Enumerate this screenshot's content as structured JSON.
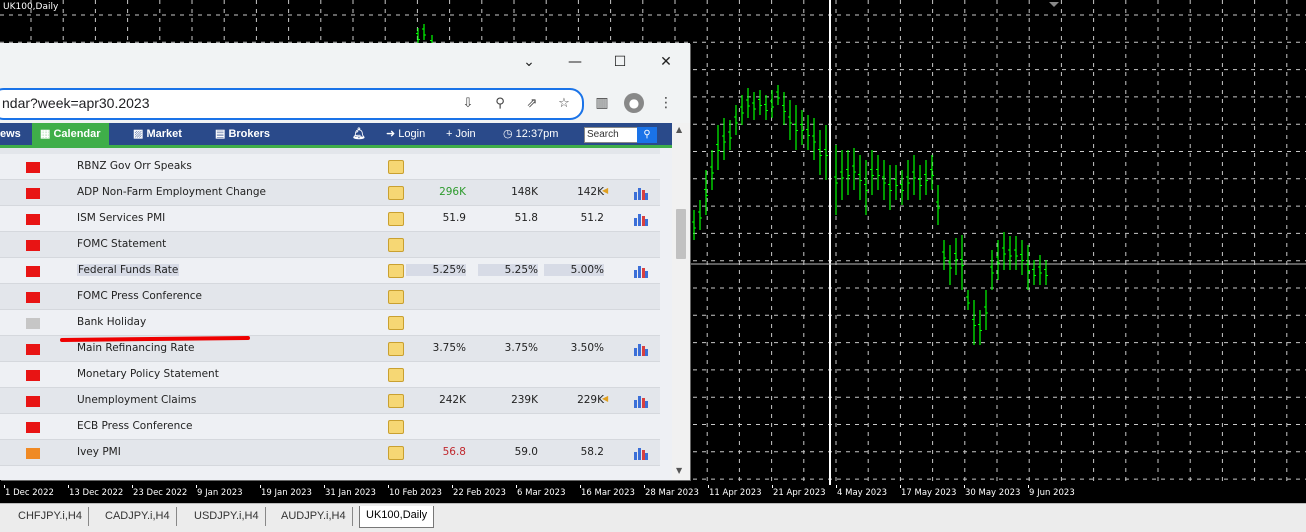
{
  "chart": {
    "title": "UK100,Daily",
    "time_labels": [
      "1 Dec 2022",
      "13 Dec 2022",
      "23 Dec 2022",
      "9 Jan 2023",
      "19 Jan 2023",
      "31 Jan 2023",
      "10 Feb 2023",
      "22 Feb 2023",
      "6 Mar 2023",
      "16 Mar 2023",
      "28 Mar 2023",
      "11 Apr 2023",
      "21 Apr 2023",
      "4 May 2023",
      "17 May 2023",
      "30 May 2023",
      "9 Jun 2023"
    ],
    "bar_color": "#00ff00",
    "grid_color": "#ffffff"
  },
  "tabs": [
    {
      "label": "CHFJPY.i,H4"
    },
    {
      "label": "CADJPY.i,H4"
    },
    {
      "label": "USDJPY.i,H4"
    },
    {
      "label": "AUDJPY.i,H4"
    },
    {
      "label": "UK100,Daily",
      "active": true
    }
  ],
  "browser": {
    "url": "ndar?week=apr30.2023",
    "nav": {
      "news": "ews",
      "calendar": "Calendar",
      "market": "Market",
      "brokers": "Brokers",
      "login": "Login",
      "join": "Join",
      "time": "12:37pm",
      "search_placeholder": "Search"
    },
    "rows": [
      {
        "name": "RBNZ Gov Orr Speaks",
        "flag": "red",
        "actual": "",
        "forecast": "",
        "previous": "",
        "chart": false
      },
      {
        "name": "ADP Non-Farm Employment Change",
        "flag": "red",
        "actual": "296K",
        "actual_color": "#2e9b2e",
        "forecast": "148K",
        "previous": "142K",
        "prev_arrow": true,
        "chart": true
      },
      {
        "name": "ISM Services PMI",
        "flag": "red",
        "actual": "51.9",
        "forecast": "51.8",
        "previous": "51.2",
        "chart": true
      },
      {
        "name": "FOMC Statement",
        "flag": "red",
        "actual": "",
        "forecast": "",
        "previous": "",
        "chart": false
      },
      {
        "name": "Federal Funds Rate",
        "flag": "red",
        "actual": "5.25%",
        "forecast": "5.25%",
        "previous": "5.00%",
        "chart": true,
        "highlight": true
      },
      {
        "name": "FOMC Press Conference",
        "flag": "red",
        "actual": "",
        "forecast": "",
        "previous": "",
        "chart": false
      },
      {
        "name": "Bank Holiday",
        "flag": "gray",
        "actual": "",
        "forecast": "",
        "previous": "",
        "chart": false
      },
      {
        "name": "Main Refinancing Rate",
        "flag": "red",
        "actual": "3.75%",
        "forecast": "3.75%",
        "previous": "3.50%",
        "chart": true
      },
      {
        "name": "Monetary Policy Statement",
        "flag": "red",
        "actual": "",
        "forecast": "",
        "previous": "",
        "chart": false
      },
      {
        "name": "Unemployment Claims",
        "flag": "red",
        "actual": "242K",
        "forecast": "239K",
        "previous": "229K",
        "prev_arrow": true,
        "chart": true
      },
      {
        "name": "ECB Press Conference",
        "flag": "red",
        "actual": "",
        "forecast": "",
        "previous": "",
        "chart": false
      },
      {
        "name": "Ivey PMI",
        "flag": "orange",
        "actual": "56.8",
        "actual_color": "#c0272d",
        "forecast": "59.0",
        "previous": "58.2",
        "chart": true
      }
    ]
  }
}
